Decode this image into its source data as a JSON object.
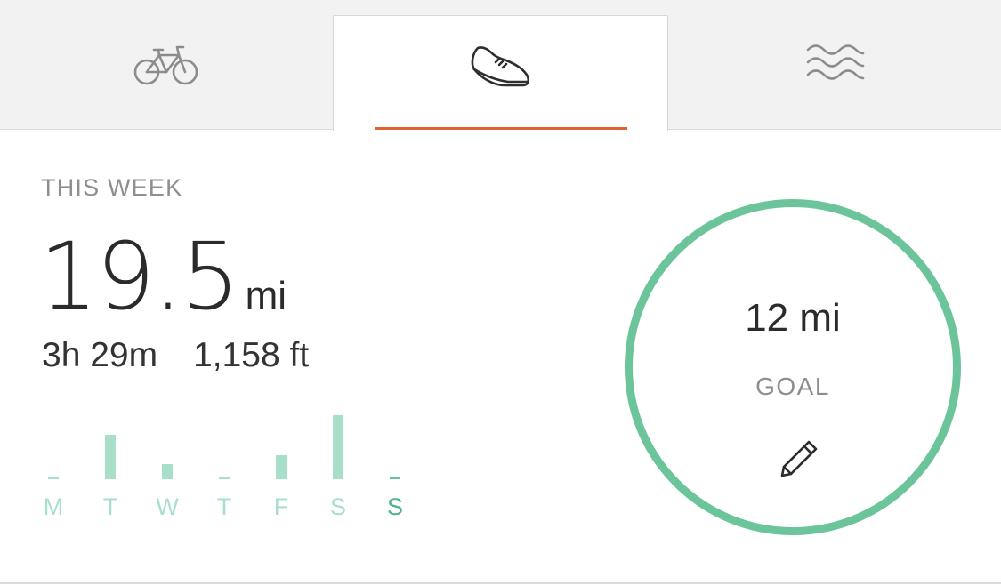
{
  "tabs": [
    {
      "id": "ride",
      "icon": "bicycle-icon",
      "selected": false
    },
    {
      "id": "run",
      "icon": "running-shoe-icon",
      "selected": true
    },
    {
      "id": "swim",
      "icon": "waves-icon",
      "selected": false
    }
  ],
  "colors": {
    "accent": "#e0642e",
    "goal_ring": "#6cc49b",
    "bar": "#a8dfc9",
    "bar_today": "#66c199"
  },
  "summary": {
    "label": "THIS WEEK",
    "distance_value": "19.5",
    "distance_unit": "mi",
    "time": "3h 29m",
    "elevation": "1,158 ft"
  },
  "week": {
    "days": [
      {
        "label": "M",
        "level": 0,
        "today": false
      },
      {
        "label": "T",
        "level": 0.69,
        "today": false
      },
      {
        "label": "W",
        "level": 0.24,
        "today": false
      },
      {
        "label": "T",
        "level": 0,
        "today": false
      },
      {
        "label": "F",
        "level": 0.38,
        "today": false
      },
      {
        "label": "S",
        "level": 1.0,
        "today": false
      },
      {
        "label": "S",
        "level": 0,
        "today": true
      }
    ]
  },
  "goal": {
    "value": "12 mi",
    "label": "GOAL",
    "edit_icon": "pencil-icon"
  }
}
